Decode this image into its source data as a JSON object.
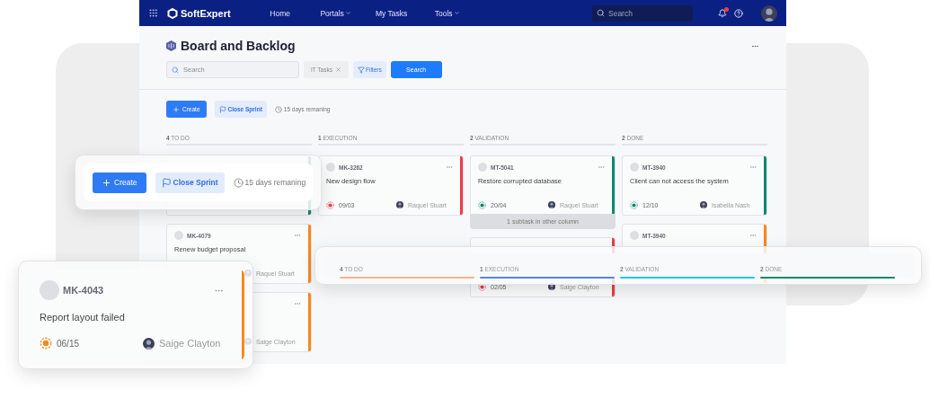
{
  "navbar": {
    "brand": "SoftExpert",
    "links": [
      {
        "label": "Home",
        "dropdown": false
      },
      {
        "label": "Portals",
        "dropdown": true
      },
      {
        "label": "My Tasks",
        "dropdown": false
      },
      {
        "label": "Tools",
        "dropdown": true
      }
    ],
    "search_placeholder": "Search",
    "notification_dot": true
  },
  "page": {
    "title": "Board and Backlog",
    "search_placeholder": "Search",
    "filter_chip": "IT Tasks",
    "filters_button": "Filters",
    "search_button": "Search"
  },
  "toolbar": {
    "create": "Create",
    "close_sprint": "Close Sprint",
    "remaining": "15 days remaning"
  },
  "columns": [
    {
      "count": "4",
      "name": "TO DO",
      "cards": [
        {
          "menu": false,
          "color": "#0e8a6d"
        },
        {
          "id": "MK-4079",
          "title": "Renew budget proposal",
          "assignee": "Raquel Stuart",
          "menu": true,
          "color": "#f7891f"
        },
        {
          "assignee": "Saige Clayton",
          "menu": true,
          "color": "#f7891f"
        }
      ]
    },
    {
      "count": "1",
      "name": "EXECUTION",
      "cards": [
        {
          "id": "MK-3262",
          "title": "New design flow",
          "date": "09/03",
          "assignee": "Raquel Stuart",
          "menu": true,
          "color": "#f0384f"
        }
      ]
    },
    {
      "count": "2",
      "name": "VALIDATION",
      "cards": [
        {
          "id": "MT-5041",
          "title": "Restore corrupted database",
          "date": "20/04",
          "assignee": "Raquel Stuart",
          "menu": true,
          "footer": "1 subtask in other column",
          "color": "#0e8a6d"
        },
        {
          "date": "02/05",
          "assignee": "Saige Clayton",
          "menu": false,
          "color": "#f0384f"
        }
      ]
    },
    {
      "count": "2",
      "name": "DONE",
      "cards": [
        {
          "id": "MT-3940",
          "title": "Client can not access the system",
          "date": "12/10",
          "assignee": "Isabella Nash",
          "menu": true,
          "color": "#0e8a6d"
        },
        {
          "id": "MT-3940",
          "menu": true,
          "color": "#f7891f"
        }
      ]
    }
  ],
  "floating_toolbar": {
    "create": "Create",
    "close_sprint": "Close Sprint",
    "remaining": "15 days remaning"
  },
  "floating_card": {
    "id": "MK-4043",
    "title": "Report layout failed",
    "date": "06/15",
    "assignee": "Saige Clayton",
    "menu": true,
    "color": "#f7891f"
  },
  "column_strip": [
    {
      "count": "4",
      "name": "TO DO",
      "color": "#f7b48a"
    },
    {
      "count": "1",
      "name": "EXECUTION",
      "color": "#4f86f7"
    },
    {
      "count": "2",
      "name": "VALIDATION",
      "color": "#22c3f0"
    },
    {
      "count": "2",
      "name": "DONE",
      "color": "#138a6c"
    }
  ]
}
